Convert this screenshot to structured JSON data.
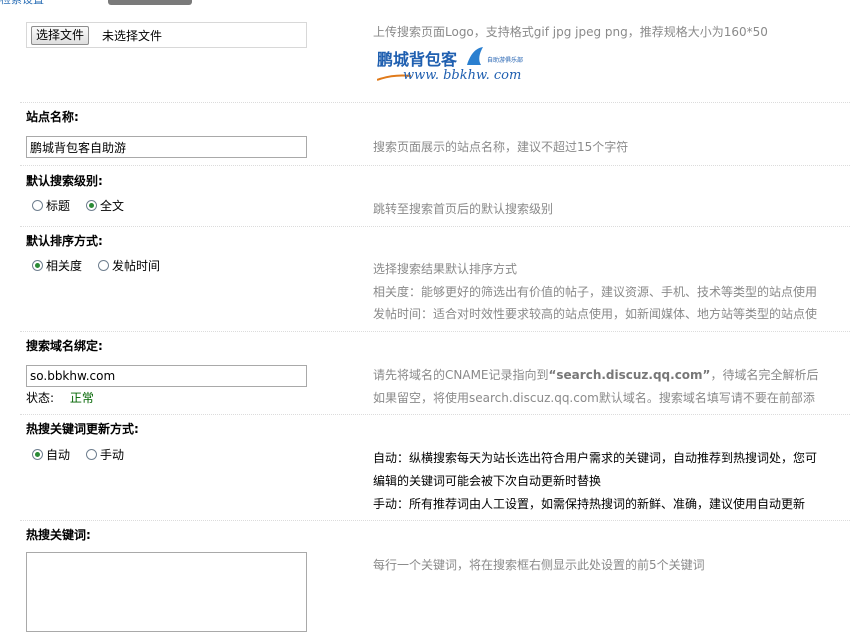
{
  "top_fragment": {
    "text": "检索设置"
  },
  "logo_section": {
    "file_button": "选择文件",
    "file_status": "未选择文件",
    "tip": "上传搜索页面Logo，支持格式gif jpg jpeg png，推荐规格大小为160*50",
    "logo_cn": "鹏城背包客",
    "logo_tag": "自助游俱乐部",
    "logo_url": "www. bbkhw. com"
  },
  "site_name": {
    "label": "站点名称:",
    "value": "鹏城背包客自助游",
    "tip": "搜索页面展示的站点名称，建议不超过15个字符"
  },
  "default_level": {
    "label": "默认搜索级别:",
    "options": [
      "标题",
      "全文"
    ],
    "selected": "全文",
    "tip": "跳转至搜索首页后的默认搜索级别"
  },
  "default_sort": {
    "label": "默认排序方式:",
    "options": [
      "相关度",
      "发帖时间"
    ],
    "selected": "相关度",
    "tip_lines": [
      "选择搜索结果默认排序方式",
      "相关度：能够更好的筛选出有价值的帖子，建议资源、手机、技术等类型的站点使用",
      "发帖时间：适合对时效性要求较高的站点使用，如新闻媒体、地方站等类型的站点使"
    ]
  },
  "domain_bind": {
    "label": "搜索域名绑定:",
    "value": "so.bbkhw.com",
    "status_label": "状态:",
    "status_value": "正常",
    "tip_prefix": "请先将域名的CNAME记录指向到",
    "tip_domain": "“search.discuz.qq.com”",
    "tip_suffix": "，待域名完全解析后",
    "tip_line2": "如果留空，将使用search.discuz.qq.com默认域名。搜索域名填写请不要在前部添"
  },
  "hot_update": {
    "label": "热搜关键词更新方式:",
    "options": [
      "自动",
      "手动"
    ],
    "selected": "自动",
    "tip_lines": [
      "自动：纵横搜索每天为站长选出符合用户需求的关键词，自动推荐到热搜词处，您可",
      "编辑的关键词可能会被下次自动更新时替换",
      "手动：所有推荐词由人工设置，如需保持热搜词的新鲜、准确，建议使用自动更新"
    ]
  },
  "hot_keywords": {
    "label": "热搜关键词:",
    "value": "",
    "tip": "每行一个关键词，将在搜索框右侧显示此处设置的前5个关键词"
  },
  "colors": {
    "status_ok": "#006400",
    "tip_gray": "#8a8a8a",
    "logo_blue": "#1f5fb0",
    "logo_orange": "#e07a1a"
  }
}
